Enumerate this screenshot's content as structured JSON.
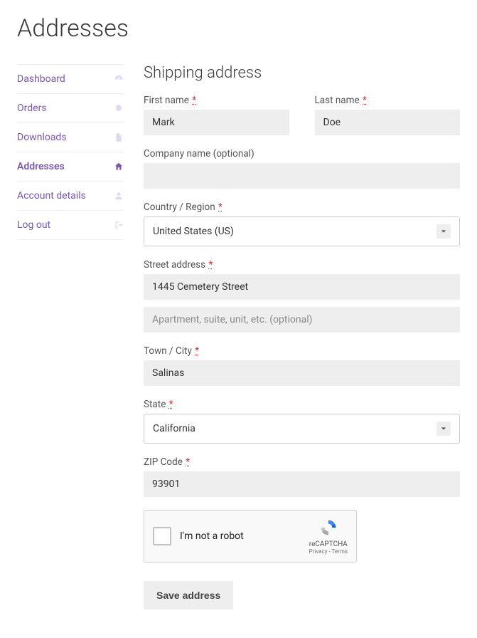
{
  "page_title": "Addresses",
  "sidebar": {
    "items": [
      {
        "label": "Dashboard",
        "icon": "gauge-icon",
        "active": false
      },
      {
        "label": "Orders",
        "icon": "basket-icon",
        "active": false
      },
      {
        "label": "Downloads",
        "icon": "file-icon",
        "active": false
      },
      {
        "label": "Addresses",
        "icon": "home-icon",
        "active": true
      },
      {
        "label": "Account details",
        "icon": "user-icon",
        "active": false
      },
      {
        "label": "Log out",
        "icon": "signout-icon",
        "active": false
      }
    ]
  },
  "form": {
    "title": "Shipping address",
    "first_name": {
      "label": "First name",
      "required": true,
      "value": "Mark"
    },
    "last_name": {
      "label": "Last name",
      "required": true,
      "value": "Doe"
    },
    "company": {
      "label": "Company name (optional)",
      "required": false,
      "value": ""
    },
    "country": {
      "label": "Country / Region",
      "required": true,
      "value": "United States (US)"
    },
    "street1": {
      "label": "Street address",
      "required": true,
      "value": "1445 Cemetery Street"
    },
    "street2": {
      "placeholder": "Apartment, suite, unit, etc. (optional)",
      "value": ""
    },
    "city": {
      "label": "Town / City",
      "required": true,
      "value": "Salinas"
    },
    "state": {
      "label": "State",
      "required": true,
      "value": "California"
    },
    "zip": {
      "label": "ZIP Code",
      "required": true,
      "value": "93901"
    },
    "recaptcha": {
      "label": "I'm not a robot",
      "brand": "reCAPTCHA",
      "legal": "Privacy - Terms"
    },
    "submit": "Save address"
  },
  "required_marker": "*"
}
